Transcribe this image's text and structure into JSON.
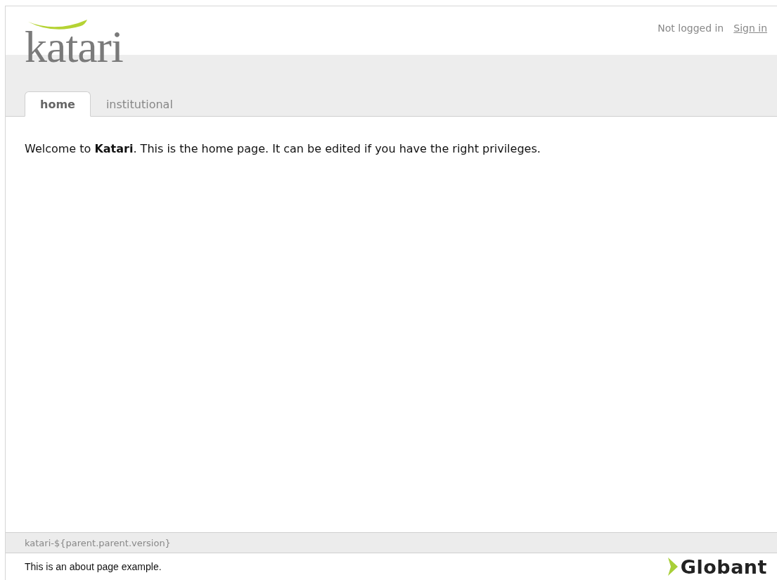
{
  "logo": {
    "text": "katari"
  },
  "session": {
    "status": "Not logged in",
    "sign_in": "Sign in"
  },
  "tabs": [
    {
      "label": "home",
      "selected": true
    },
    {
      "label": "institutional",
      "selected": false
    }
  ],
  "content": {
    "text": "Welcome to **Katari**. This is the home page. It can be edited if you have the right privileges."
  },
  "version_bar": {
    "text": "katari-${parent.parent.version}"
  },
  "footer": {
    "text": "This is an about page example.",
    "brand": "Globant"
  }
}
